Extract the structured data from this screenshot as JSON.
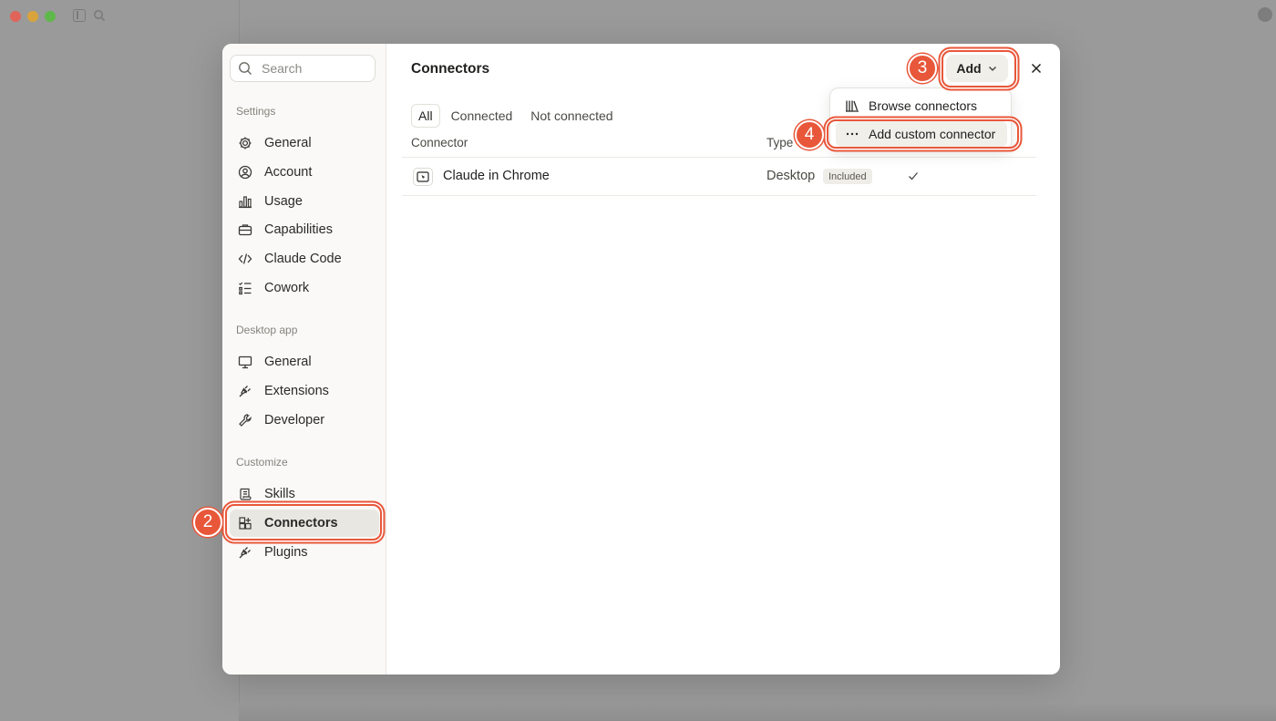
{
  "background": {
    "dim_color": "#9a9a9a"
  },
  "sidebar": {
    "search_placeholder": "Search",
    "sections": [
      {
        "label": "Settings",
        "items": [
          {
            "label": "General",
            "icon": "gear-icon"
          },
          {
            "label": "Account",
            "icon": "user-circle-icon"
          },
          {
            "label": "Usage",
            "icon": "bar-chart-icon"
          },
          {
            "label": "Capabilities",
            "icon": "briefcase-icon"
          },
          {
            "label": "Claude Code",
            "icon": "code-icon"
          },
          {
            "label": "Cowork",
            "icon": "checklist-icon"
          }
        ]
      },
      {
        "label": "Desktop app",
        "items": [
          {
            "label": "General",
            "icon": "monitor-icon"
          },
          {
            "label": "Extensions",
            "icon": "plug-icon"
          },
          {
            "label": "Developer",
            "icon": "wrench-icon"
          }
        ]
      },
      {
        "label": "Customize",
        "items": [
          {
            "label": "Skills",
            "icon": "scroll-icon"
          },
          {
            "label": "Connectors",
            "icon": "grid-plus-icon",
            "active": true
          },
          {
            "label": "Plugins",
            "icon": "plug-icon"
          }
        ]
      }
    ]
  },
  "main": {
    "title": "Connectors",
    "add_label": "Add",
    "tabs": [
      "All",
      "Connected",
      "Not connected"
    ],
    "active_tab": "All",
    "columns": {
      "connector": "Connector",
      "type": "Type"
    },
    "rows": [
      {
        "name": "Claude in Chrome",
        "type": "Desktop",
        "badge": "Included",
        "connected": true
      }
    ]
  },
  "dropdown": {
    "items": [
      {
        "label": "Browse connectors",
        "icon": "library-icon"
      },
      {
        "label": "Add custom connector",
        "icon": "ellipsis-icon"
      }
    ]
  },
  "annotations": {
    "accent": "#e8573a",
    "steps": [
      "2",
      "3",
      "4"
    ]
  }
}
